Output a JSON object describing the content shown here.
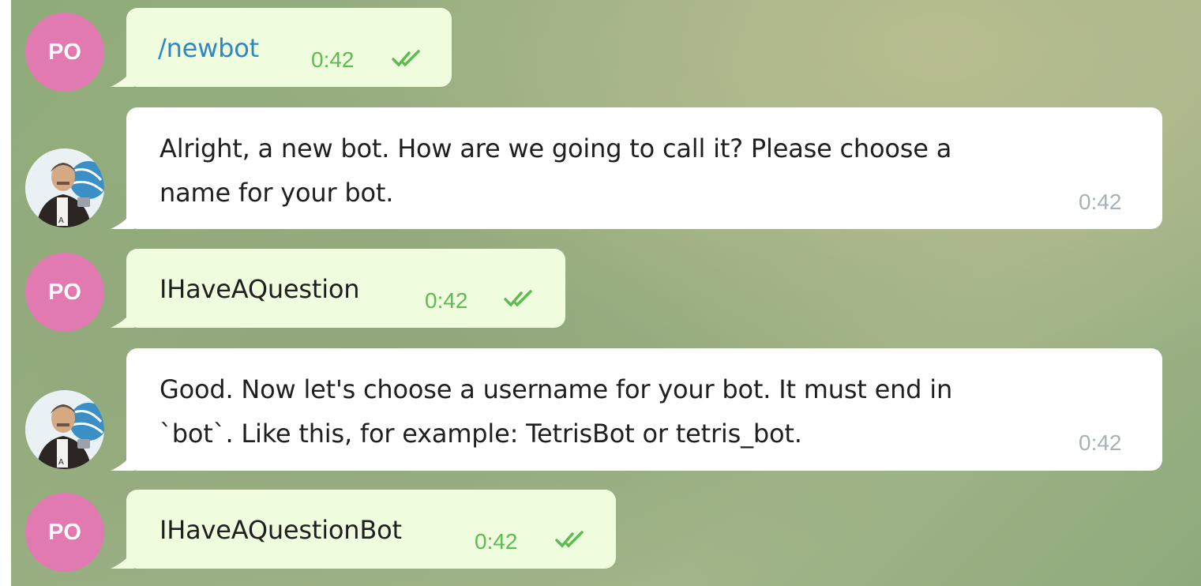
{
  "chat": {
    "messages": [
      {
        "sender": "user",
        "avatar_initials": "PO",
        "text": "/newbot",
        "time": "0:42",
        "status": "read",
        "is_command": true
      },
      {
        "sender": "bot",
        "avatar_icon": "botfather-avatar-icon",
        "lines": [
          "Alright, a new bot. How are we going to call it? Please choose a",
          "name for your bot."
        ],
        "time": "0:42"
      },
      {
        "sender": "user",
        "avatar_initials": "PO",
        "text": "IHaveAQuestion",
        "time": "0:42",
        "status": "read"
      },
      {
        "sender": "bot",
        "avatar_icon": "botfather-avatar-icon",
        "lines": [
          "Good. Now let's choose a username for your bot. It must end in",
          "`bot`. Like this, for example: TetrisBot or tetris_bot."
        ],
        "time": "0:42"
      },
      {
        "sender": "user",
        "avatar_initials": "PO",
        "text": "IHaveAQuestionBot",
        "time": "0:42",
        "status": "read"
      }
    ]
  },
  "colors": {
    "outgoing_bubble": "#effdde",
    "incoming_bubble": "#ffffff",
    "user_avatar": "#e07ab0",
    "command_link": "#2f87c7",
    "read_ticks": "#5dbb52",
    "incoming_time": "#a7b1b6"
  }
}
